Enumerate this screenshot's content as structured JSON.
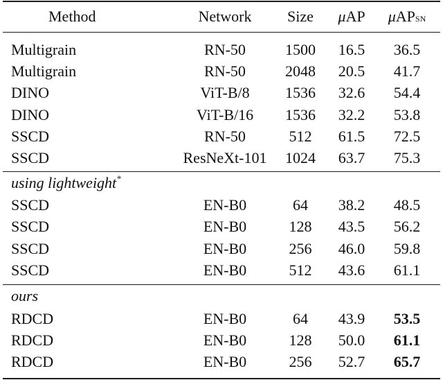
{
  "table": {
    "headers": {
      "method": "Method",
      "network": "Network",
      "size": "Size",
      "map_mu": "μ",
      "map_ap": "AP",
      "mapsn_mu": "μ",
      "mapsn_ap": "AP",
      "mapsn_sub": "SN"
    },
    "baseline_rows": [
      {
        "method": "Multigrain",
        "network": "RN-50",
        "size": "1500",
        "map": "16.5",
        "mapsn": "36.5"
      },
      {
        "method": "Multigrain",
        "network": "RN-50",
        "size": "2048",
        "map": "20.5",
        "mapsn": "41.7"
      },
      {
        "method": "DINO",
        "network": "ViT-B/8",
        "size": "1536",
        "map": "32.6",
        "mapsn": "54.4"
      },
      {
        "method": "DINO",
        "network": "ViT-B/16",
        "size": "1536",
        "map": "32.2",
        "mapsn": "53.8"
      },
      {
        "method": "SSCD",
        "network": "RN-50",
        "size": "512",
        "map": "61.5",
        "mapsn": "72.5"
      },
      {
        "method": "SSCD",
        "network": "ResNeXt-101",
        "size": "1024",
        "map": "63.7",
        "mapsn": "75.3"
      }
    ],
    "lightweight_group": {
      "label": "using lightweight",
      "footnote_mark": "*",
      "rows": [
        {
          "method": "SSCD",
          "network": "EN-B0",
          "size": "64",
          "map": "38.2",
          "mapsn": "48.5"
        },
        {
          "method": "SSCD",
          "network": "EN-B0",
          "size": "128",
          "map": "43.5",
          "mapsn": "56.2"
        },
        {
          "method": "SSCD",
          "network": "EN-B0",
          "size": "256",
          "map": "46.0",
          "mapsn": "59.8"
        },
        {
          "method": "SSCD",
          "network": "EN-B0",
          "size": "512",
          "map": "43.6",
          "mapsn": "61.1"
        }
      ]
    },
    "ours_group": {
      "label": "ours",
      "rows": [
        {
          "method": "RDCD",
          "network": "EN-B0",
          "size": "64",
          "map": "43.9",
          "mapsn": "53.5",
          "mapsn_bold": true
        },
        {
          "method": "RDCD",
          "network": "EN-B0",
          "size": "128",
          "map": "50.0",
          "mapsn": "61.1",
          "mapsn_bold": true
        },
        {
          "method": "RDCD",
          "network": "EN-B0",
          "size": "256",
          "map": "52.7",
          "mapsn": "65.7",
          "mapsn_bold": true
        }
      ]
    }
  }
}
